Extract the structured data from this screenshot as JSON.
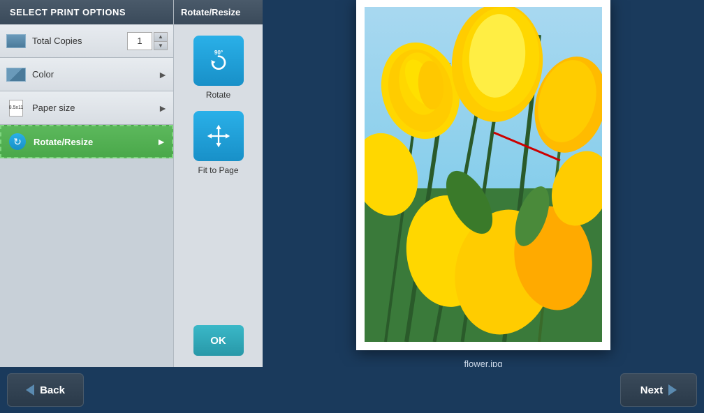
{
  "leftPanel": {
    "header": "SELECT PRINT OPTIONS",
    "options": [
      {
        "id": "total-copies",
        "label": "Total Copies",
        "type": "stepper",
        "value": "1"
      },
      {
        "id": "color",
        "label": "Color",
        "type": "nav"
      },
      {
        "id": "paper-size",
        "label": "Paper size",
        "type": "nav",
        "iconText": "8.5x11"
      },
      {
        "id": "rotate-resize",
        "label": "Rotate/Resize",
        "type": "nav-active"
      }
    ]
  },
  "middlePanel": {
    "header": "Rotate/Resize",
    "buttons": [
      {
        "id": "rotate",
        "label": "Rotate",
        "icon": "rotate-icon"
      },
      {
        "id": "fit-to-page",
        "label": "Fit to Page",
        "icon": "move-icon"
      }
    ],
    "okLabel": "OK"
  },
  "preview": {
    "filename": "flower.jpg"
  },
  "bottomBar": {
    "backLabel": "Back",
    "nextLabel": "Next"
  }
}
